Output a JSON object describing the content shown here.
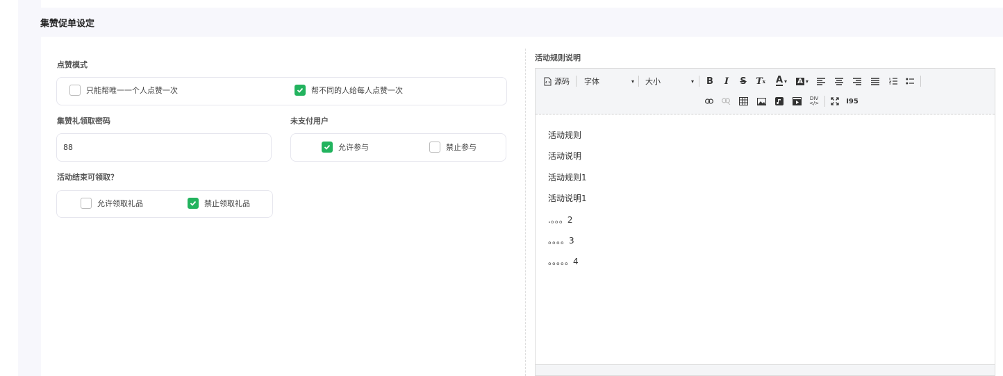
{
  "header": {
    "title": "集赞促单设定"
  },
  "like_mode": {
    "label": "点赞模式",
    "options": [
      {
        "label": "只能帮唯一一个人点赞一次",
        "checked": false
      },
      {
        "label": "帮不同的人给每人点赞一次",
        "checked": true
      }
    ]
  },
  "password": {
    "label": "集赞礼领取密码",
    "value": "88"
  },
  "unpaid": {
    "label": "未支付用户",
    "options": [
      {
        "label": "允许参与",
        "checked": true
      },
      {
        "label": "禁止参与",
        "checked": false
      }
    ]
  },
  "after_end": {
    "label": "活动结束可领取？",
    "options": [
      {
        "label": "允许领取礼品",
        "checked": false
      },
      {
        "label": "禁止领取礼品",
        "checked": true
      }
    ]
  },
  "rules": {
    "label": "活动规则说明",
    "toolbar": {
      "source": "源码",
      "font": "字体",
      "size": "大小"
    },
    "lines": [
      "活动规则",
      "活动说明",
      "活动规则1",
      "活动说明1",
      ".。。。2",
      "。。。。3",
      "。。。。。4"
    ]
  },
  "colors": {
    "accent": "#22b35e"
  }
}
